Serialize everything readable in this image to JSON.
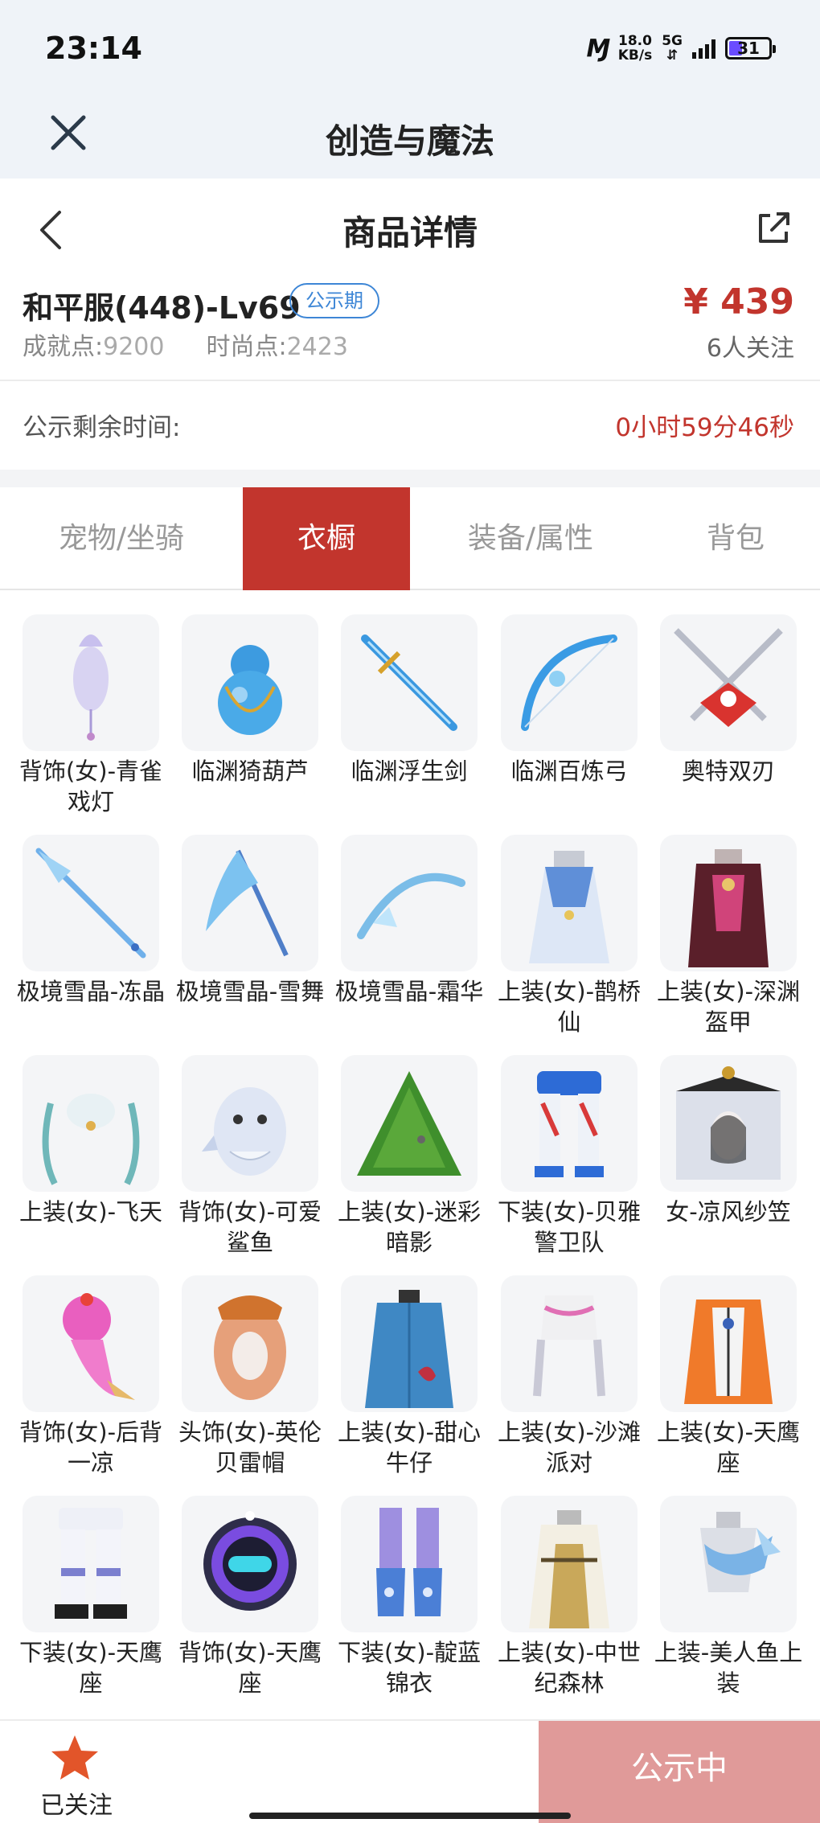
{
  "status": {
    "time": "23:14",
    "network_speed": "18.0",
    "speed_unit": "KB/s",
    "network_type": "5G",
    "battery": "31"
  },
  "app": {
    "title": "创造与魔法"
  },
  "nav": {
    "title": "商品详情"
  },
  "product": {
    "name": "和平服(448)-Lv69",
    "badge": "公示期",
    "achievement_label": "成就点:",
    "achievement_value": "9200",
    "fashion_label": "时尚点:",
    "fashion_value": "2423",
    "price": "¥ 439",
    "watchers": "6人关注"
  },
  "countdown": {
    "label": "公示剩余时间:",
    "value": "0小时59分46秒"
  },
  "tabs": [
    {
      "label": "宠物/坐骑"
    },
    {
      "label": "衣橱"
    },
    {
      "label": "装备/属性"
    },
    {
      "label": "背包"
    }
  ],
  "active_tab": "衣橱",
  "items": [
    {
      "name": "背饰(女)-青雀戏灯",
      "icon": "lantern-accessory-icon"
    },
    {
      "name": "临渊猗葫芦",
      "icon": "gourd-icon"
    },
    {
      "name": "临渊浮生剑",
      "icon": "sword-icon"
    },
    {
      "name": "临渊百炼弓",
      "icon": "bow-icon"
    },
    {
      "name": "奥特双刃",
      "icon": "dual-blades-icon"
    },
    {
      "name": "极境雪晶-冻晶",
      "icon": "ice-spear-icon"
    },
    {
      "name": "极境雪晶-雪舞",
      "icon": "ice-scythe-icon"
    },
    {
      "name": "极境雪晶-霜华",
      "icon": "ice-bow-icon"
    },
    {
      "name": "上装(女)-鹊桥仙",
      "icon": "dress-icon"
    },
    {
      "name": "上装(女)-深渊盔甲",
      "icon": "armor-icon"
    },
    {
      "name": "上装(女)-飞天",
      "icon": "celestial-top-icon"
    },
    {
      "name": "背饰(女)-可爱鲨鱼",
      "icon": "shark-icon"
    },
    {
      "name": "上装(女)-迷彩暗影",
      "icon": "ghillie-icon"
    },
    {
      "name": "下装(女)-贝雅警卫队",
      "icon": "guard-pants-icon"
    },
    {
      "name": "女-凉风纱笠",
      "icon": "veil-hat-icon"
    },
    {
      "name": "背饰(女)-后背一凉",
      "icon": "ice-cream-icon"
    },
    {
      "name": "头饰(女)-英伦贝雷帽",
      "icon": "beret-icon"
    },
    {
      "name": "上装(女)-甜心牛仔",
      "icon": "denim-top-icon"
    },
    {
      "name": "上装(女)-沙滩派对",
      "icon": "beach-top-icon"
    },
    {
      "name": "上装(女)-天鹰座",
      "icon": "aquila-top-icon"
    },
    {
      "name": "下装(女)-天鹰座",
      "icon": "aquila-pants-icon"
    },
    {
      "name": "背饰(女)-天鹰座",
      "icon": "aquila-backpack-icon"
    },
    {
      "name": "下装(女)-靛蓝锦衣",
      "icon": "indigo-pants-icon"
    },
    {
      "name": "上装(女)-中世纪森林",
      "icon": "medieval-dress-icon"
    },
    {
      "name": "上装-美人鱼上装",
      "icon": "mermaid-top-icon"
    }
  ],
  "bottom": {
    "follow_label": "已关注",
    "status_button": "公示中"
  },
  "colors": {
    "accent": "#c2352d",
    "badge": "#3d86d6",
    "disabled_button": "#e09a99",
    "header_bg": "#eff3f8"
  }
}
